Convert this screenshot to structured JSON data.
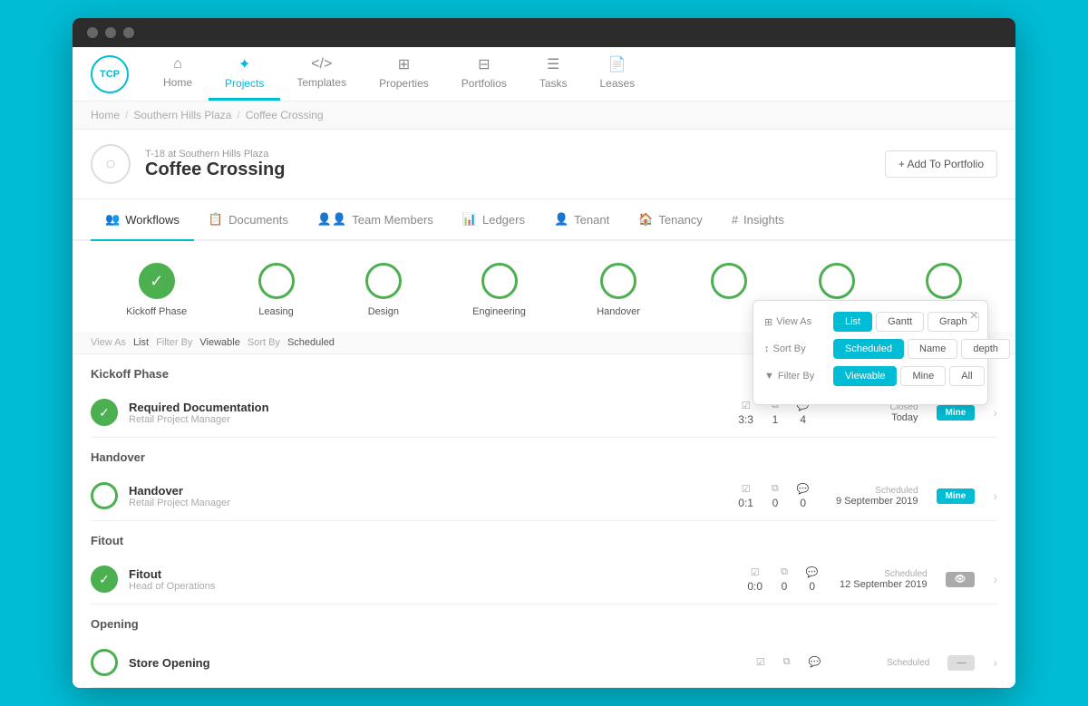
{
  "browser": {
    "dots": [
      "dot1",
      "dot2",
      "dot3"
    ]
  },
  "nav": {
    "logo": "TCP",
    "items": [
      {
        "label": "Home",
        "icon": "⌂",
        "active": false
      },
      {
        "label": "Projects",
        "icon": "⟁",
        "active": true
      },
      {
        "label": "Templates",
        "icon": "</>",
        "active": false
      },
      {
        "label": "Properties",
        "icon": "▦",
        "active": false
      },
      {
        "label": "Portfolios",
        "icon": "▤",
        "active": false
      },
      {
        "label": "Tasks",
        "icon": "☰",
        "active": false
      },
      {
        "label": "Leases",
        "icon": "📄",
        "active": false
      }
    ]
  },
  "breadcrumb": {
    "items": [
      "Home",
      "Southern Hills Plaza",
      "Coffee Crossing"
    ],
    "separators": [
      "/",
      "/"
    ]
  },
  "project": {
    "subtitle": "T-18 at Southern Hills Plaza",
    "title": "Coffee Crossing",
    "add_portfolio_label": "+ Add To Portfolio"
  },
  "tabs": [
    {
      "label": "Workflows",
      "icon": "👥",
      "active": true
    },
    {
      "label": "Documents",
      "icon": "📋",
      "active": false
    },
    {
      "label": "Team Members",
      "icon": "👤",
      "active": false
    },
    {
      "label": "Ledgers",
      "icon": "📊",
      "active": false
    },
    {
      "label": "Tenant",
      "icon": "👤",
      "active": false
    },
    {
      "label": "Tenancy",
      "icon": "🏠",
      "active": false
    },
    {
      "label": "Insights",
      "icon": "#",
      "active": false
    }
  ],
  "workflow_steps": [
    {
      "label": "Kickoff Phase",
      "done": true
    },
    {
      "label": "Leasing",
      "done": false
    },
    {
      "label": "Design",
      "done": false
    },
    {
      "label": "Engineering",
      "done": false
    },
    {
      "label": "Handover",
      "done": false
    },
    {
      "label": "",
      "done": false
    },
    {
      "label": "",
      "done": false
    },
    {
      "label": "",
      "done": false
    }
  ],
  "toolbar": {
    "view_as_label": "View As",
    "view_as_value": "List",
    "filter_by_label": "Filter By",
    "filter_by_value": "Viewable",
    "sort_by_label": "Sort By",
    "sort_by_value": "Scheduled"
  },
  "sections": [
    {
      "name": "Kickoff Phase",
      "tasks": [
        {
          "name": "Required Documentation",
          "role": "Retail Project Manager",
          "done": true,
          "checks": "3:3",
          "copies": "1",
          "comments": "4",
          "status_label": "Closed",
          "date": "Today",
          "badge": "Mine",
          "badge_type": "mine"
        }
      ]
    },
    {
      "name": "Handover",
      "tasks": [
        {
          "name": "Handover",
          "role": "Retail Project Manager",
          "done": false,
          "checks": "0:1",
          "copies": "0",
          "comments": "0",
          "status_label": "Scheduled",
          "date": "9 September 2019",
          "badge": "Mine",
          "badge_type": "mine"
        }
      ]
    },
    {
      "name": "Fitout",
      "tasks": [
        {
          "name": "Fitout",
          "role": "Head of Operations",
          "done": true,
          "checks": "0:0",
          "copies": "0",
          "comments": "0",
          "status_label": "Scheduled",
          "date": "12 September 2019",
          "badge": "eye",
          "badge_type": "eye"
        }
      ]
    },
    {
      "name": "Opening",
      "tasks": [
        {
          "name": "Store Opening",
          "role": "",
          "done": false,
          "checks": "",
          "copies": "",
          "comments": "",
          "status_label": "Scheduled",
          "date": "",
          "badge": "dash",
          "badge_type": "dash"
        }
      ]
    }
  ],
  "popup": {
    "view_as_label": "View As",
    "sort_by_label": "Sort By",
    "filter_by_label": "Filter By",
    "view_options": [
      "List",
      "Gantt",
      "Graph"
    ],
    "sort_options": [
      "Scheduled",
      "Name",
      "depth"
    ],
    "filter_options": [
      "Viewable",
      "Mine",
      "All"
    ],
    "active_view": "List",
    "active_sort": "Scheduled",
    "active_filter": "Viewable"
  }
}
